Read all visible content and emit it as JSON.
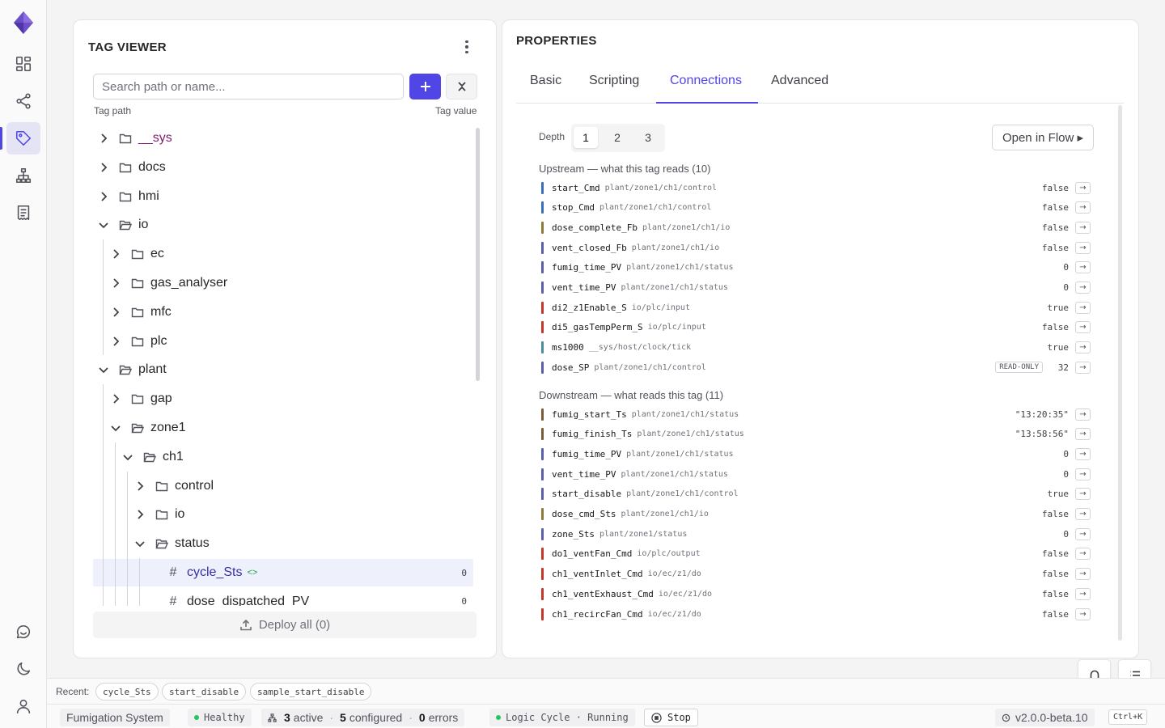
{
  "nav": {
    "items": [
      {
        "icon": "dashboard-icon"
      },
      {
        "icon": "share-graph-icon"
      },
      {
        "icon": "tag-icon",
        "active": true
      },
      {
        "icon": "hierarchy-icon"
      },
      {
        "icon": "receipt-icon"
      }
    ],
    "bottom_items": [
      {
        "icon": "chat-icon"
      },
      {
        "icon": "moon-icon"
      },
      {
        "icon": "user-icon"
      }
    ]
  },
  "tag_viewer": {
    "title": "TAG VIEWER",
    "search_placeholder": "Search path or name...",
    "col_path": "Tag path",
    "col_value": "Tag value",
    "tree": [
      {
        "label": "__sys",
        "type": "folder",
        "depth": 0,
        "expanded": false
      },
      {
        "label": "docs",
        "type": "folder",
        "depth": 0,
        "expanded": false
      },
      {
        "label": "hmi",
        "type": "folder",
        "depth": 0,
        "expanded": false
      },
      {
        "label": "io",
        "type": "folder",
        "depth": 0,
        "expanded": true
      },
      {
        "label": "ec",
        "type": "folder",
        "depth": 1,
        "expanded": false
      },
      {
        "label": "gas_analyser",
        "type": "folder",
        "depth": 1,
        "expanded": false
      },
      {
        "label": "mfc",
        "type": "folder",
        "depth": 1,
        "expanded": false
      },
      {
        "label": "plc",
        "type": "folder",
        "depth": 1,
        "expanded": false
      },
      {
        "label": "plant",
        "type": "folder",
        "depth": 0,
        "expanded": true
      },
      {
        "label": "gap",
        "type": "folder",
        "depth": 1,
        "expanded": false
      },
      {
        "label": "zone1",
        "type": "folder",
        "depth": 1,
        "expanded": true
      },
      {
        "label": "ch1",
        "type": "folder",
        "depth": 2,
        "expanded": true
      },
      {
        "label": "control",
        "type": "folder",
        "depth": 3,
        "expanded": false
      },
      {
        "label": "io",
        "type": "folder",
        "depth": 3,
        "expanded": false
      },
      {
        "label": "status",
        "type": "folder",
        "depth": 3,
        "expanded": true
      },
      {
        "label": "cycle_Sts",
        "type": "tag",
        "depth": 4,
        "value": "0",
        "selected": true,
        "linked_icon": "<>"
      },
      {
        "label": "dose_dispatched_PV",
        "type": "tag",
        "depth": 4,
        "value": "0"
      }
    ],
    "deploy_label": "Deploy all (0)"
  },
  "properties": {
    "title": "PROPERTIES",
    "tabs": [
      "Basic",
      "Scripting",
      "Connections",
      "Advanced"
    ],
    "active_tab": "Connections",
    "depth_label": "Depth",
    "depth_options": [
      "1",
      "2",
      "3"
    ],
    "depth_selected": "1",
    "open_flow_label": "Open in Flow ▸",
    "upstream_title": "Upstream — what this tag reads (10)",
    "upstream": [
      {
        "name": "start_Cmd",
        "path": "plant/zone1/ch1/control",
        "value": "false",
        "color": "#3b6fb6"
      },
      {
        "name": "stop_Cmd",
        "path": "plant/zone1/ch1/control",
        "value": "false",
        "color": "#3b6fb6"
      },
      {
        "name": "dose_complete_Fb",
        "path": "plant/zone1/ch1/io",
        "value": "false",
        "color": "#8c7a3a"
      },
      {
        "name": "vent_closed_Fb",
        "path": "plant/zone1/ch1/io",
        "value": "false",
        "color": "#5b5fa8"
      },
      {
        "name": "fumig_time_PV",
        "path": "plant/zone1/ch1/status",
        "value": "0",
        "color": "#5b5fa8"
      },
      {
        "name": "vent_time_PV",
        "path": "plant/zone1/ch1/status",
        "value": "0",
        "color": "#5b5fa8"
      },
      {
        "name": "di2_z1Enable_S",
        "path": "io/plc/input",
        "value": "true",
        "color": "#c0392b"
      },
      {
        "name": "di5_gasTempPerm_S",
        "path": "io/plc/input",
        "value": "false",
        "color": "#c0392b"
      },
      {
        "name": "ms1000",
        "path": "__sys/host/clock/tick",
        "value": "true",
        "color": "#4a8f9a"
      },
      {
        "name": "dose_SP",
        "path": "plant/zone1/ch1/control",
        "value": "32",
        "color": "#5b5fa8",
        "badge": "READ-ONLY"
      }
    ],
    "downstream_title": "Downstream — what reads this tag (11)",
    "downstream": [
      {
        "name": "fumig_start_Ts",
        "path": "plant/zone1/ch1/status",
        "value": "\"13:20:35\"",
        "color": "#7a5c3a"
      },
      {
        "name": "fumig_finish_Ts",
        "path": "plant/zone1/ch1/status",
        "value": "\"13:58:56\"",
        "color": "#7a5c3a"
      },
      {
        "name": "fumig_time_PV",
        "path": "plant/zone1/ch1/status",
        "value": "0",
        "color": "#5b5fa8"
      },
      {
        "name": "vent_time_PV",
        "path": "plant/zone1/ch1/status",
        "value": "0",
        "color": "#5b5fa8"
      },
      {
        "name": "start_disable",
        "path": "plant/zone1/ch1/control",
        "value": "true",
        "color": "#5b5fa8"
      },
      {
        "name": "dose_cmd_Sts",
        "path": "plant/zone1/ch1/io",
        "value": "false",
        "color": "#8c7a3a"
      },
      {
        "name": "zone_Sts",
        "path": "plant/zone1/status",
        "value": "0",
        "color": "#5b5fa8"
      },
      {
        "name": "do1_ventFan_Cmd",
        "path": "io/plc/output",
        "value": "false",
        "color": "#c0392b"
      },
      {
        "name": "ch1_ventInlet_Cmd",
        "path": "io/ec/z1/do",
        "value": "false",
        "color": "#c0392b"
      },
      {
        "name": "ch1_ventExhaust_Cmd",
        "path": "io/ec/z1/do",
        "value": "false",
        "color": "#c0392b"
      },
      {
        "name": "ch1_recircFan_Cmd",
        "path": "io/ec/z1/do",
        "value": "false",
        "color": "#c0392b"
      }
    ],
    "go_glyph": "→"
  },
  "recent": {
    "label": "Recent:",
    "items": [
      "cycle_Sts",
      "start_disable",
      "sample_start_disable"
    ]
  },
  "status": {
    "system": "Fumigation System",
    "health": "Healthy",
    "active_count": "3",
    "active_label": "active",
    "configured_count": "5",
    "configured_label": "configured",
    "errors_count": "0",
    "errors_label": "errors",
    "logic": "Logic Cycle · Running",
    "stop_label": "Stop",
    "version": "v2.0.0-beta.10",
    "shortcut": "Ctrl+K"
  }
}
